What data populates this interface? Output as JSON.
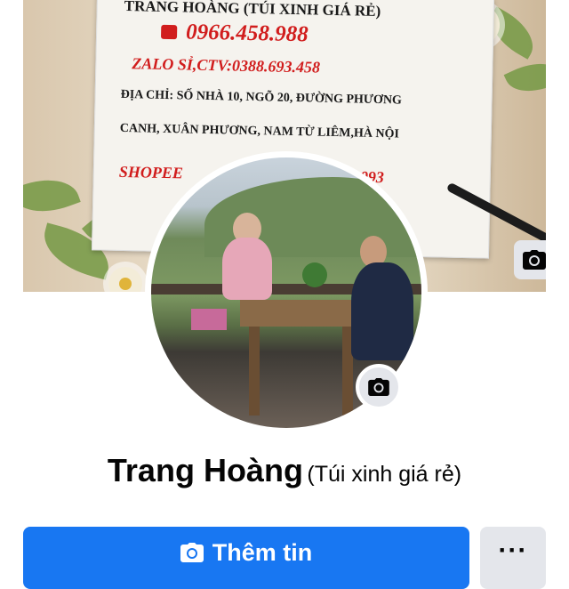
{
  "cover": {
    "line1": "TRANG HOÀNG (TÚI XINH GIÁ RẺ)",
    "phone": "0966.458.988",
    "zalo": "ZALO SỈ,CTV:0388.693.458",
    "address1": "ĐỊA CHỈ: SỐ NHÀ 10, NGÕ 20, ĐƯỜNG PHƯƠNG",
    "address2": "CANH, XUÂN PHƯƠNG, NAM TỪ LIÊM,HÀ NỘI",
    "shopee_start": "SHOPEE",
    "shopee_end": "1093"
  },
  "profile": {
    "name": "Trang Hoàng",
    "alias": "(Túi xinh giá rẻ)"
  },
  "actions": {
    "add_story_label": "Thêm tin",
    "more_label": "···"
  },
  "colors": {
    "primary": "#1877f2",
    "secondary_button": "#e4e6eb",
    "text": "#050505"
  },
  "icons": {
    "cover_camera": "camera-icon",
    "avatar_camera": "camera-icon",
    "add_story": "camera-icon",
    "more": "more-dots-icon"
  }
}
